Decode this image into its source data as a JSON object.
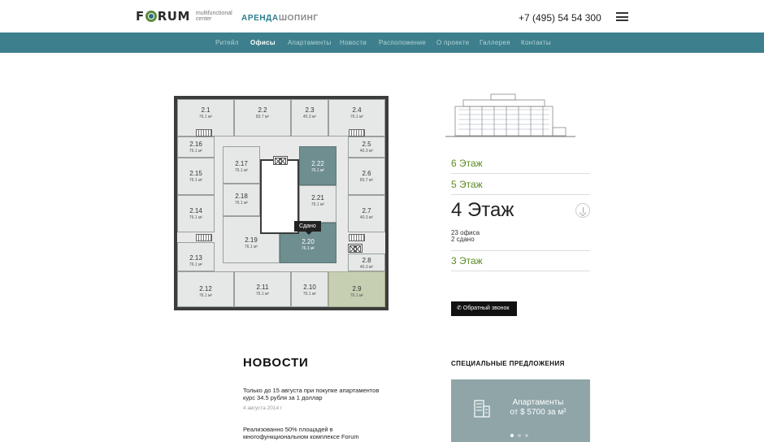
{
  "header": {
    "logo_text": "FORUM",
    "logo_sub": "multifunctional center",
    "link_rent": "АРЕНДА",
    "link_shop": "ШОПИНГ",
    "phone": "+7 (495) 54 54 300",
    "menu_icon": "hamburger-icon"
  },
  "nav": {
    "items": [
      "Ритейл",
      "Офисы",
      "Апартаменты",
      "Новости",
      "Расположение",
      "О проекте",
      "Галлерея",
      "Контакты"
    ],
    "active": "Офисы"
  },
  "plan": {
    "tooltip": "Сдано",
    "offices": [
      {
        "num": "2.1",
        "area": "76.1 м²",
        "status": "free"
      },
      {
        "num": "2.2",
        "area": "83.7 м²",
        "status": "free"
      },
      {
        "num": "2.3",
        "area": "40.3 м²",
        "status": "free"
      },
      {
        "num": "2.4",
        "area": "76.1 м²",
        "status": "free"
      },
      {
        "num": "2.16",
        "area": "76.1 м²",
        "status": "free"
      },
      {
        "num": "2.5",
        "area": "40.3 м²",
        "status": "free"
      },
      {
        "num": "2.17",
        "area": "76.1 м²",
        "status": "free"
      },
      {
        "num": "2.22",
        "area": "76.1 м²",
        "status": "rented"
      },
      {
        "num": "2.15",
        "area": "76.1 м²",
        "status": "free"
      },
      {
        "num": "2.6",
        "area": "83.7 м²",
        "status": "free"
      },
      {
        "num": "2.18",
        "area": "76.1 м²",
        "status": "free"
      },
      {
        "num": "2.21",
        "area": "76.1 м²",
        "status": "free"
      },
      {
        "num": "2.14",
        "area": "76.1 м²",
        "status": "free"
      },
      {
        "num": "2.7",
        "area": "40.3 м²",
        "status": "free"
      },
      {
        "num": "2.19",
        "area": "76.1 м²",
        "status": "free"
      },
      {
        "num": "2.20",
        "area": "76.1 м²",
        "status": "rented"
      },
      {
        "num": "2.13",
        "area": "76.1 м²",
        "status": "free"
      },
      {
        "num": "2.8",
        "area": "40.3 м²",
        "status": "free"
      },
      {
        "num": "2.12",
        "area": "76.1 м²",
        "status": "free"
      },
      {
        "num": "2.11",
        "area": "76.1 м²",
        "status": "free"
      },
      {
        "num": "2.10",
        "area": "76.1 м²",
        "status": "free"
      },
      {
        "num": "2.9",
        "area": "76.1 м²",
        "status": "selected"
      }
    ]
  },
  "floors": {
    "f6": "6 Этаж",
    "f5": "5 Этаж",
    "current": "4 Этаж",
    "offices_count": "23 офиса",
    "rented_count": "2 сдано",
    "f3": "3 Этаж",
    "callback": "✆ Обратный звонок"
  },
  "news": {
    "title": "НОВОСТИ",
    "items": [
      {
        "text": "Только до 15 августа при покупке апартаментов курс 34.5 рубля за 1 доллар",
        "date": "4 августа 2014 г"
      },
      {
        "text": "Реализованно 50% площадей в многофункциональном комплексе Forum",
        "date": ""
      }
    ]
  },
  "offers": {
    "title": "СПЕЦИАЛЬНЫЕ ПРЕДЛОЖЕНИЯ",
    "card_line1": "Апартаменты",
    "card_line2": "от $ 5700 за м²"
  },
  "colors": {
    "accent": "#3d7f8c",
    "floor_link": "#5a8b22",
    "rented": "#6f8e8f",
    "selected": "#c6cfb2",
    "offer_card": "#8fa5a8"
  }
}
